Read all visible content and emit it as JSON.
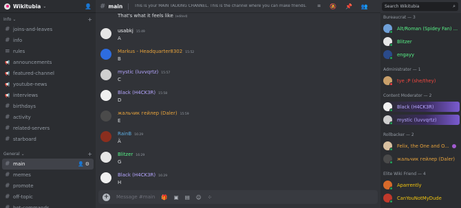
{
  "server": {
    "name": "Wikitubia"
  },
  "sidebar": {
    "categories": [
      {
        "label": "Info"
      },
      {
        "label": "General"
      }
    ],
    "info_channels": [
      {
        "label": "joins-and-leaves",
        "icon": "hash-icon"
      },
      {
        "label": "info",
        "icon": "hash-icon"
      },
      {
        "label": "rules",
        "icon": "rules-icon"
      },
      {
        "label": "announcements",
        "icon": "megaphone-icon"
      },
      {
        "label": "featured-channel",
        "icon": "megaphone-icon"
      },
      {
        "label": "youtube-news",
        "icon": "megaphone-icon"
      },
      {
        "label": "interviews",
        "icon": "megaphone-icon"
      },
      {
        "label": "birthdays",
        "icon": "hash-icon"
      },
      {
        "label": "activity",
        "icon": "hash-icon"
      },
      {
        "label": "related-servers",
        "icon": "hash-icon"
      },
      {
        "label": "starboard",
        "icon": "hash-icon"
      }
    ],
    "general_channels": [
      {
        "label": "main",
        "icon": "hash-icon",
        "active": true
      },
      {
        "label": "memes",
        "icon": "hash-icon"
      },
      {
        "label": "promote",
        "icon": "hash-icon"
      },
      {
        "label": "off-topic",
        "icon": "hash-icon"
      },
      {
        "label": "bot-commands",
        "icon": "hash-icon"
      }
    ]
  },
  "header": {
    "channel": "main",
    "topic": "This is your MAIN TALKING CHANNEL. This is the channel where you can make friends.",
    "icons": [
      "threads-icon",
      "mute-icon",
      "pin-icon",
      "members-icon"
    ]
  },
  "search": {
    "placeholder": "Search Wikitubia"
  },
  "messages": [
    {
      "author": "",
      "time": "",
      "text": "That's what it feels like",
      "edited": "(edited)",
      "color": "#dbdee1",
      "continuation": true
    },
    {
      "author": "usabkj",
      "time": "15:49",
      "text": "A",
      "color": "#f2f3f5",
      "avatar": "#e6e6e6"
    },
    {
      "author": "Markus - Headquarter8302",
      "time": "15:52",
      "text": "B",
      "color": "#e6a23c",
      "avatar": "#2d6cdf"
    },
    {
      "author": "mystic (luvvqrtz)",
      "time": "15:57",
      "text": "C",
      "color": "#b5a6ff",
      "avatar": "#cfcfcf"
    },
    {
      "author": "Black (H4CK3R)",
      "time": "15:58",
      "text": "D",
      "color": "#b5a6ff",
      "avatar": "#f0f0f0"
    },
    {
      "author": "жальчик гейлер (Daler)",
      "time": "15:59",
      "text": "E",
      "color": "#e6a23c",
      "avatar": "#4a4a4a"
    },
    {
      "author": "RainB",
      "time": "16:29",
      "text": "Ä",
      "color": "#5dade2",
      "avatar": "#8b2e1e"
    },
    {
      "author": "Blitzer",
      "time": "16:29",
      "text": "G",
      "color": "#57f287",
      "avatar": "#e6e6e6"
    },
    {
      "author": "Black (H4CK3R)",
      "time": "16:29",
      "text": "H",
      "color": "#b5a6ff",
      "avatar": "#f0f0f0"
    }
  ],
  "composer": {
    "placeholder": "Message #main",
    "icons": [
      "gift-icon",
      "gif-icon",
      "sticker-icon",
      "emoji-icon",
      "apps-icon"
    ]
  },
  "members": {
    "groups": [
      {
        "label": "Bureaucrat — 3",
        "items": [
          {
            "name": "Alt/Roman (Spidey Fan) ...",
            "color": "#57f287",
            "avatar": "#6fa0d8"
          },
          {
            "name": "Blitzer",
            "color": "#57f287",
            "avatar": "#e6e6e6"
          },
          {
            "name": "engayy",
            "color": "#57f287",
            "avatar": "#2a4a8a"
          }
        ]
      },
      {
        "label": "Administrator — 1",
        "items": [
          {
            "name": "tye ;P (she/they)",
            "color": "#f2473f",
            "avatar": "#c9a06a"
          }
        ]
      },
      {
        "label": "Content Moderator — 2",
        "items": [
          {
            "name": "Black (H4CK3R)",
            "color": "#b5a6ff",
            "avatar": "#f0f0f0",
            "banner": true
          },
          {
            "name": "mystic (luvvqrtz)",
            "color": "#b5a6ff",
            "avatar": "#cfcfcf",
            "banner": true
          }
        ]
      },
      {
        "label": "Rollbacker — 2",
        "items": [
          {
            "name": "Felix, the One and O...",
            "color": "#e6a23c",
            "avatar": "#d8c0a0",
            "badge": true
          },
          {
            "name": "жальчик гейлер (Daler)",
            "color": "#e6a23c",
            "avatar": "#4a4a4a"
          }
        ]
      },
      {
        "label": "Elite Wiki Friend — 4",
        "items": [
          {
            "name": "Aparrently",
            "color": "#f1c40f",
            "avatar": "#d86a2a"
          },
          {
            "name": "CanYouNotMyDude",
            "color": "#f1c40f",
            "avatar": "#c0392b"
          }
        ]
      }
    ]
  },
  "colors": {
    "accent": "#5865f2",
    "online": "#23a55a",
    "dnd": "#f23f43"
  }
}
